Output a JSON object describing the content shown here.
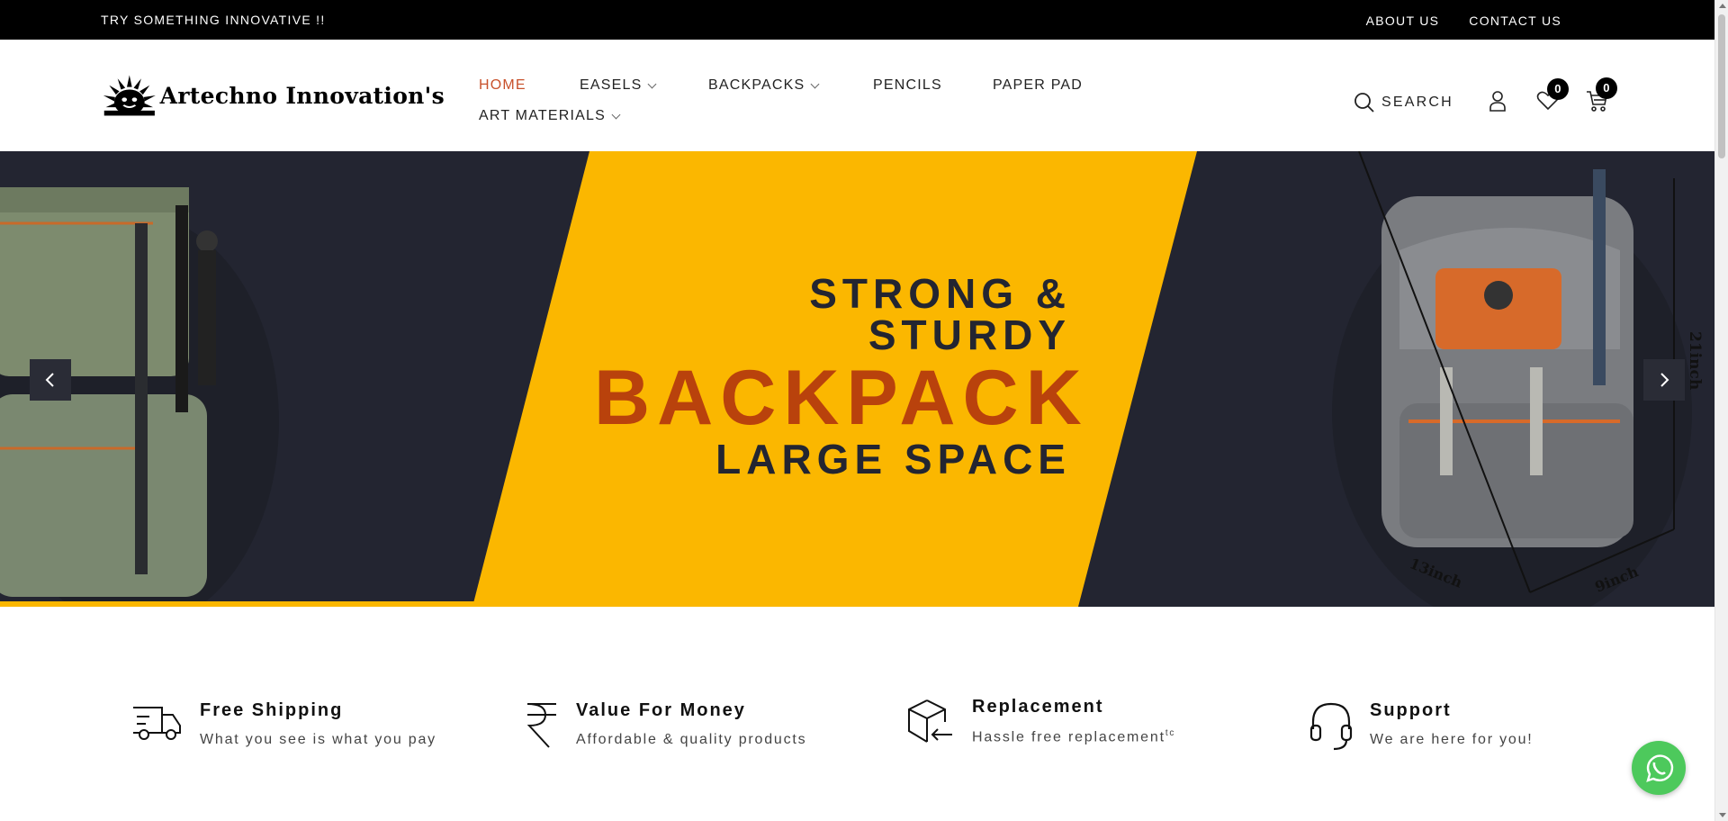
{
  "topbar": {
    "promo": "TRY SOMETHING INNOVATIVE !!",
    "about": "ABOUT US",
    "contact": "CONTACT US"
  },
  "header": {
    "logo_text": "Artechno Innovation's",
    "nav": {
      "home": "HOME",
      "easels": "EASELS",
      "backpacks": "BACKPACKS",
      "pencils": "PENCILS",
      "paper_pad": "PAPER PAD",
      "art_materials": "ART MATERIALS"
    },
    "search_label": "SEARCH",
    "wishlist_count": "0",
    "cart_count": "0"
  },
  "hero": {
    "line1": "STRONG & STURDY",
    "line2": "BACKPACK",
    "line3": "LARGE SPACE",
    "right_dim_height": "21inch",
    "right_dim_width": "13inch",
    "right_dim_depth": "9inch",
    "slide_progress": 0.41,
    "colors": {
      "background": "#232531",
      "accent": "#fbb700",
      "headline": "#b9420c"
    }
  },
  "features": [
    {
      "title": "Free Shipping",
      "desc": "What you see is what you pay",
      "icon": "truck-icon"
    },
    {
      "title": "Value For Money",
      "desc": "Affordable & quality products",
      "icon": "rupee-icon"
    },
    {
      "title": "Replacement",
      "desc": "Hassle free replacement",
      "sup": "tc",
      "icon": "box-return-icon"
    },
    {
      "title": "Support",
      "desc": "We are here for you!",
      "icon": "headset-icon"
    }
  ]
}
